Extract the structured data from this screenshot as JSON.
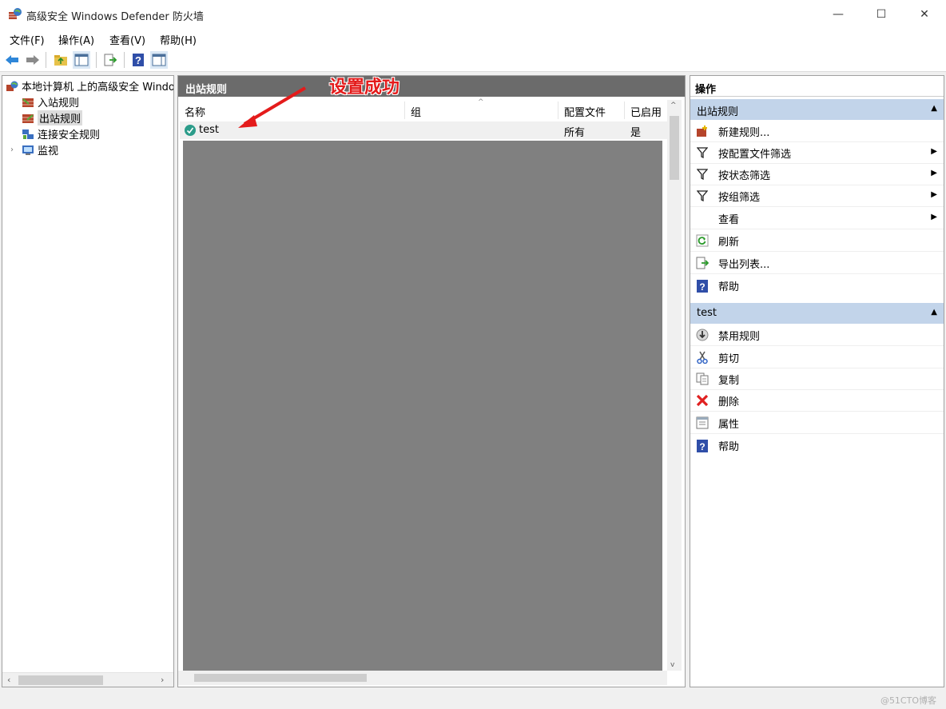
{
  "window": {
    "title": "高级安全 Windows Defender 防火墙",
    "minimize": "—",
    "maximize": "☐",
    "close": "✕"
  },
  "menu": [
    "文件(F)",
    "操作(A)",
    "查看(V)",
    "帮助(H)"
  ],
  "tree": {
    "root": "本地计算机 上的高级安全 Windows Defender 防火墙",
    "items": [
      "入站规则",
      "出站规则",
      "连接安全规则",
      "监视"
    ],
    "selected": "出站规则"
  },
  "center": {
    "header": "出站规则",
    "columns": [
      "名称",
      "组",
      "配置文件",
      "已启用"
    ],
    "rows": [
      {
        "name": "test",
        "group": "",
        "profile": "所有",
        "enabled": "是"
      }
    ]
  },
  "annotation": "设置成功",
  "actions": {
    "title": "操作",
    "section1": {
      "header": "出站规则",
      "items": [
        "新建规则...",
        "按配置文件筛选",
        "按状态筛选",
        "按组筛选",
        "查看",
        "刷新",
        "导出列表...",
        "帮助"
      ]
    },
    "section2": {
      "header": "test",
      "items": [
        "禁用规则",
        "剪切",
        "复制",
        "删除",
        "属性",
        "帮助"
      ]
    }
  },
  "watermark": "@51CTO博客",
  "colors": {
    "accent": "#c2d4ea",
    "annotation": "#e41b1b",
    "header_bg": "#6b6b6b"
  }
}
